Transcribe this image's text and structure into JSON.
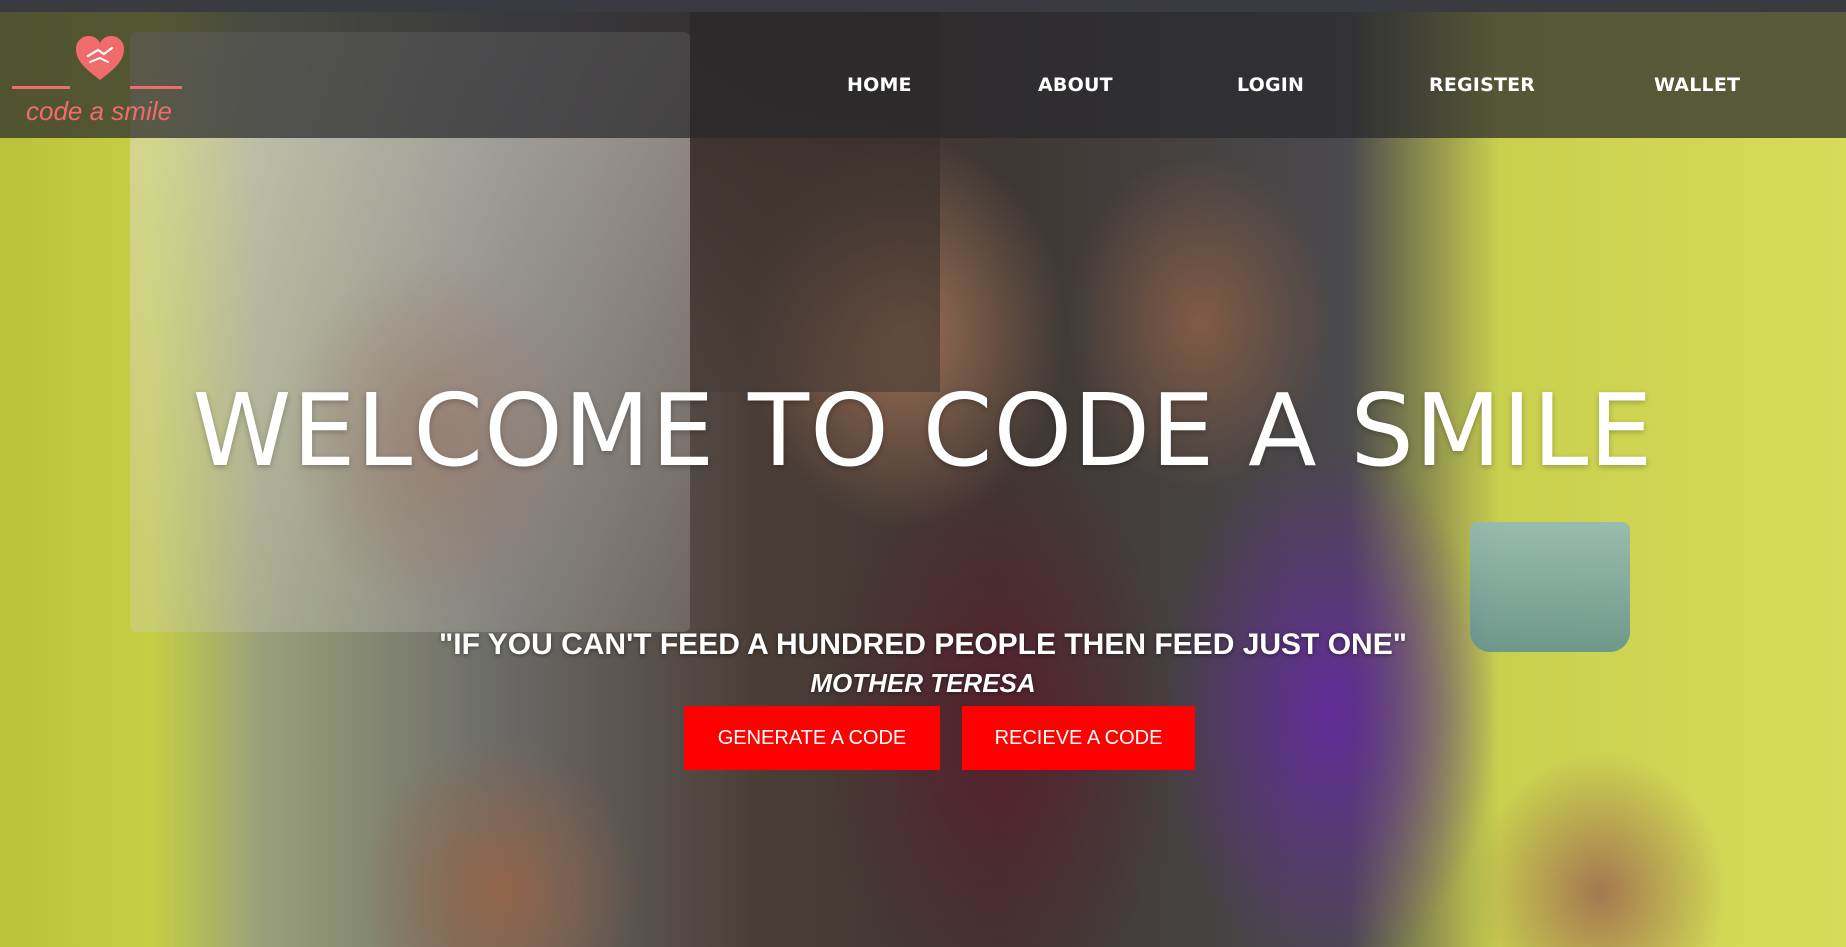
{
  "logo": {
    "text": "code a smile",
    "color": "#f06c6c",
    "icon": "heart-hands-icon"
  },
  "nav": {
    "items": [
      {
        "label": "HOME"
      },
      {
        "label": "ABOUT"
      },
      {
        "label": "LOGIN"
      },
      {
        "label": "REGISTER"
      },
      {
        "label": "WALLET"
      }
    ]
  },
  "hero": {
    "title": "WELCOME TO CODE A SMILE",
    "quote": "\"IF YOU CAN'T FEED A HUNDRED PEOPLE THEN FEED JUST ONE\"",
    "author": "MOTHER TERESA"
  },
  "buttons": {
    "generate_label": "GENERATE A CODE",
    "receive_label": "RECIEVE A CODE",
    "color": "#ff0000"
  }
}
